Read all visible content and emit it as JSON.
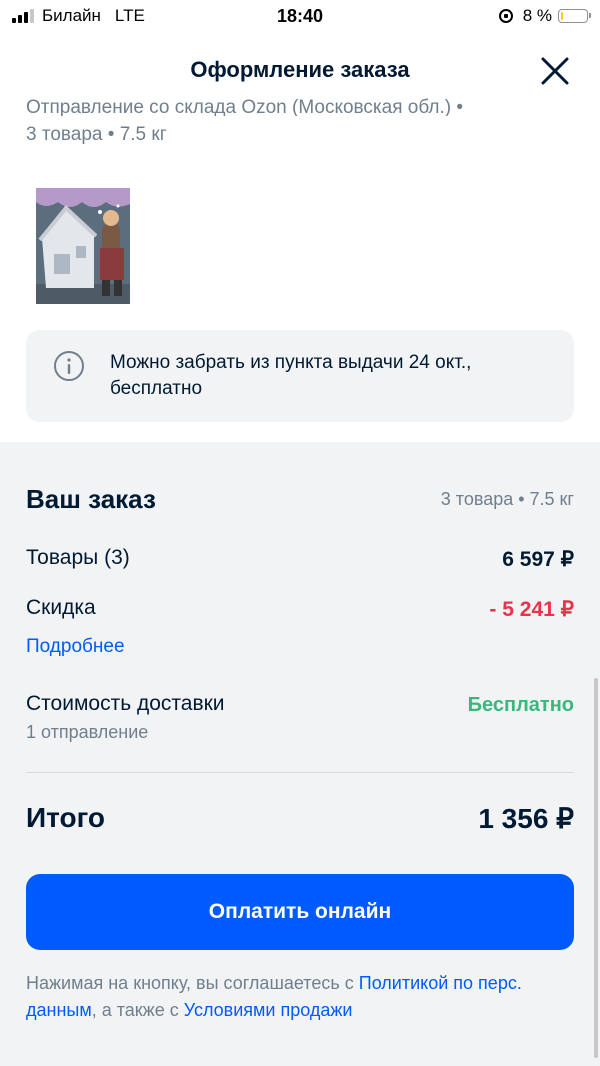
{
  "status_bar": {
    "carrier": "Билайн",
    "network": "LTE",
    "time": "18:40",
    "battery": "8 %",
    "battery_level": 0.08
  },
  "header": {
    "title": "Оформление заказа"
  },
  "shipment": {
    "origin": "Отправление со склада Ozon (Московская обл.) •",
    "summary": "3 товара • 7.5 кг"
  },
  "info_banner": {
    "text": "Можно забрать из пункта выдачи 24 окт., бесплатно"
  },
  "order": {
    "title": "Ваш заказ",
    "meta": "3 товара • 7.5 кг",
    "goods_label": "Товары (3)",
    "goods_value": "6 597 ₽",
    "discount_label": "Скидка",
    "discount_value": "- 5 241 ₽",
    "details_link": "Подробнее",
    "delivery_label": "Стоимость доставки",
    "delivery_value": "Бесплатно",
    "delivery_sub": "1 отправление",
    "total_label": "Итого",
    "total_value": "1 356 ₽"
  },
  "pay_button": {
    "label": "Оплатить онлайн"
  },
  "legal": {
    "text_1": "Нажимая на кнопку, вы соглашаетесь с ",
    "link_1": "Политикой по перс. данным",
    "text_2": ", а также с ",
    "link_2": "Условиями продажи"
  },
  "colors": {
    "accent": "#005bff",
    "discount": "#e9334b",
    "free": "#38b87c",
    "text": "#001a34",
    "muted": "#707f8d"
  }
}
